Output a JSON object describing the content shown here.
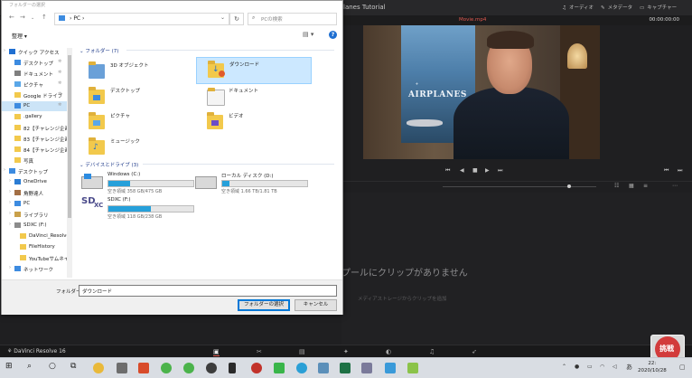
{
  "resolve": {
    "title": "lanes Tutorial",
    "tabs": [
      {
        "label": "オーディオ",
        "icon": "music-note-icon"
      },
      {
        "label": "メタデータ",
        "icon": "metadata-icon"
      },
      {
        "label": "キャプチャー",
        "icon": "capture-icon"
      }
    ],
    "clip_name": "Movie.mp4",
    "timecode": "00:00:00:00",
    "viewer_poster_text": "AIRPLANES",
    "media_pool_empty": "プールにクリップがありません",
    "media_pool_hint": "メディアストレージからクリップを追加",
    "app_label": "DaVinci Resolve 16",
    "accent": "#e05a50"
  },
  "dialog": {
    "title": "フォルダーの選択",
    "breadcrumb": [
      "PC"
    ],
    "search_placeholder": "PCの検索",
    "organize_label": "整理 ▾",
    "nav_items": [
      {
        "label": "クイック アクセス",
        "icon": "star-icon",
        "indent": 0,
        "pinned": false,
        "selected": false
      },
      {
        "label": "デスクトップ",
        "icon": "desktop-icon",
        "indent": 1,
        "pinned": true,
        "selected": false
      },
      {
        "label": "ドキュメント",
        "icon": "document-icon",
        "indent": 1,
        "pinned": true,
        "selected": false
      },
      {
        "label": "ピクチャ",
        "icon": "pictures-icon",
        "indent": 1,
        "pinned": true,
        "selected": false
      },
      {
        "label": "Google ドライブ",
        "icon": "drive-icon",
        "indent": 1,
        "pinned": true,
        "selected": false
      },
      {
        "label": "PC",
        "icon": "pc-icon",
        "indent": 1,
        "pinned": true,
        "selected": true
      },
      {
        "label": ".gallery",
        "icon": "folder-icon",
        "indent": 1,
        "pinned": false,
        "selected": false
      },
      {
        "label": "82【チャレンジ企画",
        "icon": "folder-icon",
        "indent": 1,
        "pinned": false,
        "selected": false
      },
      {
        "label": "83【チャレンジ企画",
        "icon": "folder-icon",
        "indent": 1,
        "pinned": false,
        "selected": false
      },
      {
        "label": "84【チャレンジ企画",
        "icon": "folder-icon",
        "indent": 1,
        "pinned": false,
        "selected": false
      },
      {
        "label": "写真",
        "icon": "folder-icon",
        "indent": 1,
        "pinned": false,
        "selected": false
      },
      {
        "label": "デスクトップ",
        "icon": "desktop-icon",
        "indent": 0,
        "pinned": false,
        "selected": false
      },
      {
        "label": "OneDrive",
        "icon": "onedrive-icon",
        "indent": 1,
        "pinned": false,
        "selected": false
      },
      {
        "label": "角野達人",
        "icon": "user-icon",
        "indent": 1,
        "pinned": false,
        "selected": false
      },
      {
        "label": "PC",
        "icon": "pc-icon",
        "indent": 1,
        "pinned": false,
        "selected": false
      },
      {
        "label": "ライブラリ",
        "icon": "library-icon",
        "indent": 1,
        "pinned": false,
        "selected": false
      },
      {
        "label": "SDXC (F:)",
        "icon": "sd-card-icon",
        "indent": 1,
        "pinned": false,
        "selected": false
      },
      {
        "label": "DaVinci_Resolve",
        "icon": "folder-icon",
        "indent": 2,
        "pinned": false,
        "selected": false
      },
      {
        "label": "FileHistory",
        "icon": "folder-icon",
        "indent": 2,
        "pinned": false,
        "selected": false
      },
      {
        "label": "YouTubeサムネイル",
        "icon": "folder-icon",
        "indent": 2,
        "pinned": false,
        "selected": false
      },
      {
        "label": "ネットワーク",
        "icon": "network-icon",
        "indent": 1,
        "pinned": false,
        "selected": false
      }
    ],
    "folders_header": "フォルダー (7)",
    "folders": [
      {
        "label": "3D オブジェクト",
        "icon": "3d-objects-icon",
        "selected": false
      },
      {
        "label": "ダウンロード",
        "icon": "download-folder-icon",
        "selected": true
      },
      {
        "label": "デスクトップ",
        "icon": "desktop-folder-icon",
        "selected": false
      },
      {
        "label": "ドキュメント",
        "icon": "documents-folder-icon",
        "selected": false
      },
      {
        "label": "ピクチャ",
        "icon": "pictures-folder-icon",
        "selected": false
      },
      {
        "label": "ビデオ",
        "icon": "videos-folder-icon",
        "selected": false
      },
      {
        "label": "ミュージック",
        "icon": "music-folder-icon",
        "selected": false
      }
    ],
    "drives_header": "デバイスとドライブ (3)",
    "drives": [
      {
        "name": "Windows (C:)",
        "icon": "windows-drive-icon",
        "free_text": "空き領域 358 GB/475 GB",
        "used_fraction": 0.25
      },
      {
        "name": "ローカル ディスク (D:)",
        "icon": "hard-drive-icon",
        "free_text": "空き領域 1.66 TB/1.81 TB",
        "used_fraction": 0.08
      },
      {
        "name": "SDXC (F:)",
        "icon": "sdxc-drive-icon",
        "free_text": "空き領域 118 GB/238 GB",
        "used_fraction": 0.5
      }
    ],
    "folder_label": "フォルダー:",
    "folder_value": "ダウンロード",
    "select_button": "フォルダーの選択",
    "cancel_button": "キャンセル"
  },
  "taskbar": {
    "ime": "あ",
    "clock_time": "22:",
    "clock_date": "2020/10/28",
    "icons": [
      "start-icon",
      "search-icon",
      "cortana-icon",
      "task-view-icon",
      "chrome-icon",
      "settings-icon",
      "video-app-icon",
      "chrome-icon",
      "chrome-icon",
      "davinci-icon",
      "phone-icon",
      "record-icon",
      "line-icon",
      "telegram-icon",
      "app-icon",
      "excel-icon",
      "files-icon",
      "photos-icon",
      "pen-icon"
    ]
  },
  "overlay": {
    "stamp_text": "挑戦"
  }
}
